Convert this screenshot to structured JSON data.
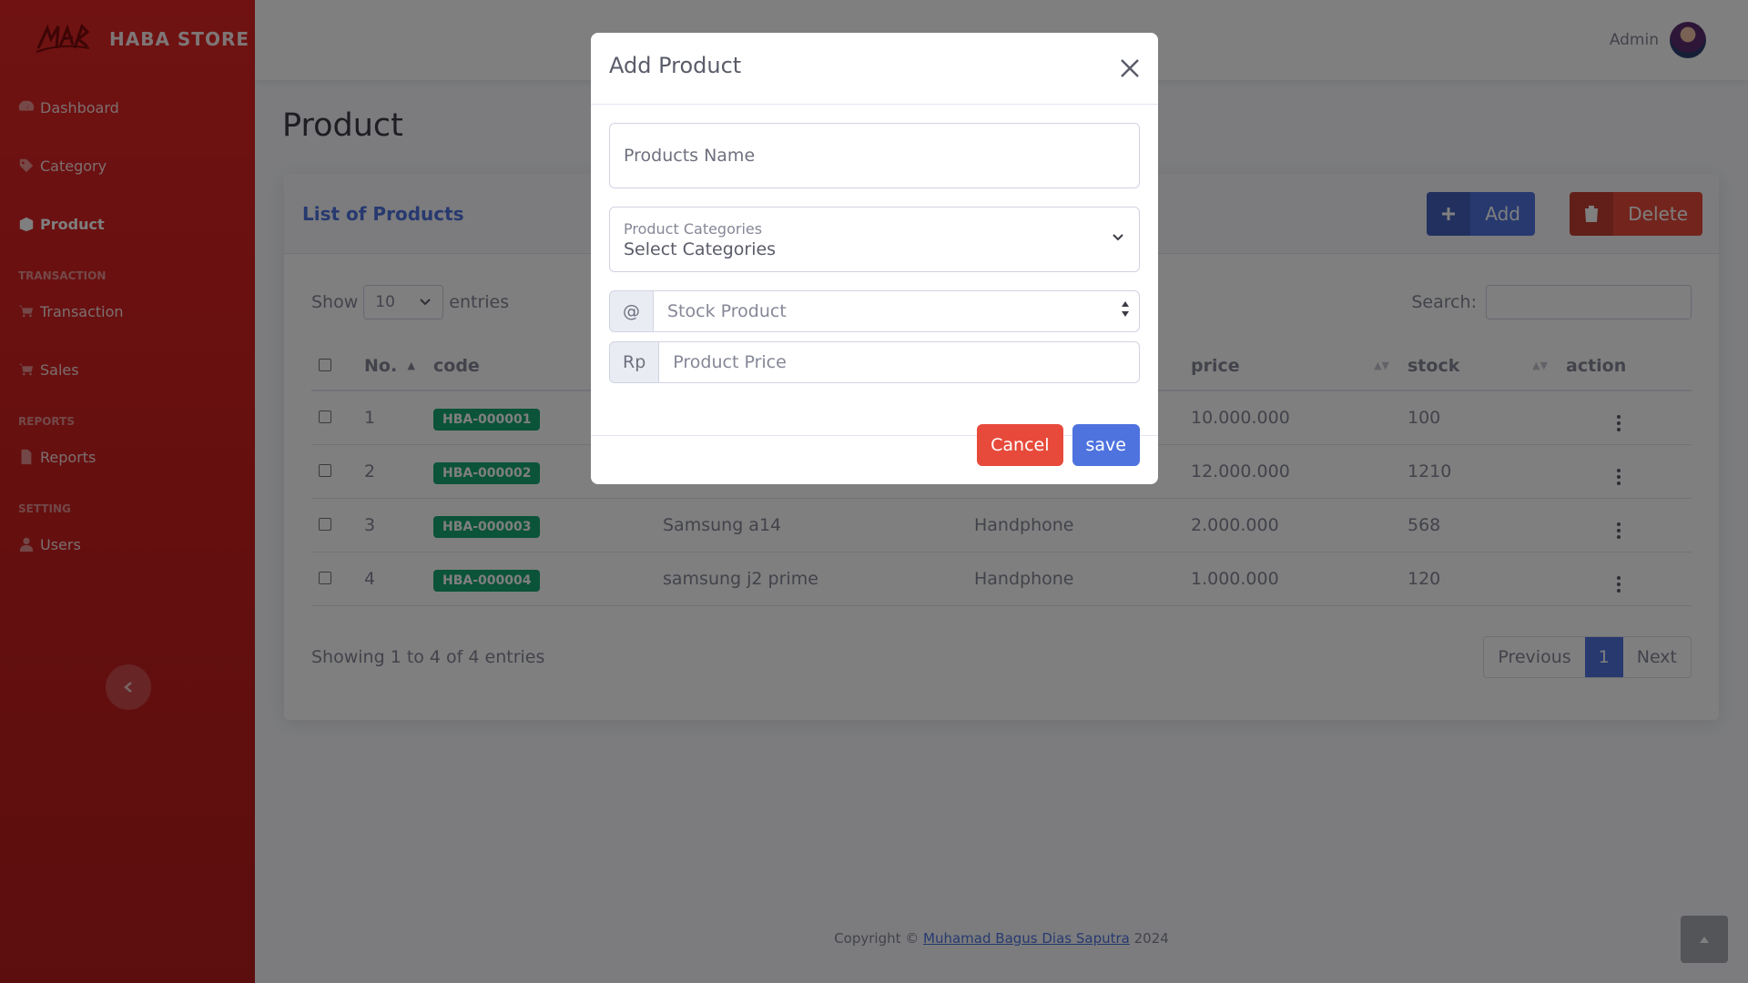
{
  "brand": {
    "name": "HABA STORE"
  },
  "sidebar": {
    "items": [
      {
        "label": "Dashboard",
        "icon": "dashboard-icon"
      },
      {
        "label": "Category",
        "icon": "tags-icon"
      },
      {
        "label": "Product",
        "icon": "box-icon",
        "active": true
      }
    ],
    "heading_transaction": "TRANSACTION",
    "transaction_items": [
      {
        "label": "Transaction",
        "icon": "cart-icon"
      },
      {
        "label": "Sales",
        "icon": "cart-icon"
      }
    ],
    "heading_reports": "REPORTS",
    "reports_items": [
      {
        "label": "Reports",
        "icon": "file-icon"
      }
    ],
    "heading_setting": "SETTING",
    "setting_items": [
      {
        "label": "Users",
        "icon": "user-icon"
      }
    ]
  },
  "topbar": {
    "user_name": "Admin"
  },
  "page": {
    "title": "Product"
  },
  "card": {
    "title": "List of Products",
    "add_label": "Add",
    "delete_label": "Delete"
  },
  "table_controls": {
    "show_label": "Show",
    "entries_value": "10",
    "entries_label": "entries",
    "search_label": "Search:"
  },
  "table": {
    "columns": [
      "No.",
      "code",
      "price",
      "stock",
      "action"
    ],
    "rows": [
      {
        "no": "1",
        "code": "HBA-000001",
        "name": "",
        "category": "",
        "price": "10.000.000",
        "stock": "100"
      },
      {
        "no": "2",
        "code": "HBA-000002",
        "name": "",
        "category": "",
        "price": "12.000.000",
        "stock": "1210"
      },
      {
        "no": "3",
        "code": "HBA-000003",
        "name": "Samsung a14",
        "category": "Handphone",
        "price": "2.000.000",
        "stock": "568"
      },
      {
        "no": "4",
        "code": "HBA-000004",
        "name": "samsung j2 prime",
        "category": "Handphone",
        "price": "1.000.000",
        "stock": "120"
      }
    ]
  },
  "pagination": {
    "info": "Showing 1 to 4 of 4 entries",
    "previous": "Previous",
    "current": "1",
    "next": "Next"
  },
  "footer": {
    "prefix": "Copyright ©",
    "author": "Muhamad Bagus Dias Saputra",
    "year": "2024"
  },
  "modal": {
    "title": "Add Product",
    "product_name_placeholder": "Products Name",
    "category_label": "Product Categories",
    "category_value": "Select Categories",
    "stock_addon": "@",
    "stock_placeholder": "Stock Product",
    "price_addon": "Rp",
    "price_placeholder": "Product Price",
    "cancel_label": "Cancel",
    "save_label": "save"
  },
  "colors": {
    "sidebar": "#c81e1e",
    "primary": "#4e73df",
    "danger": "#e74a3b",
    "success": "#17a673"
  }
}
